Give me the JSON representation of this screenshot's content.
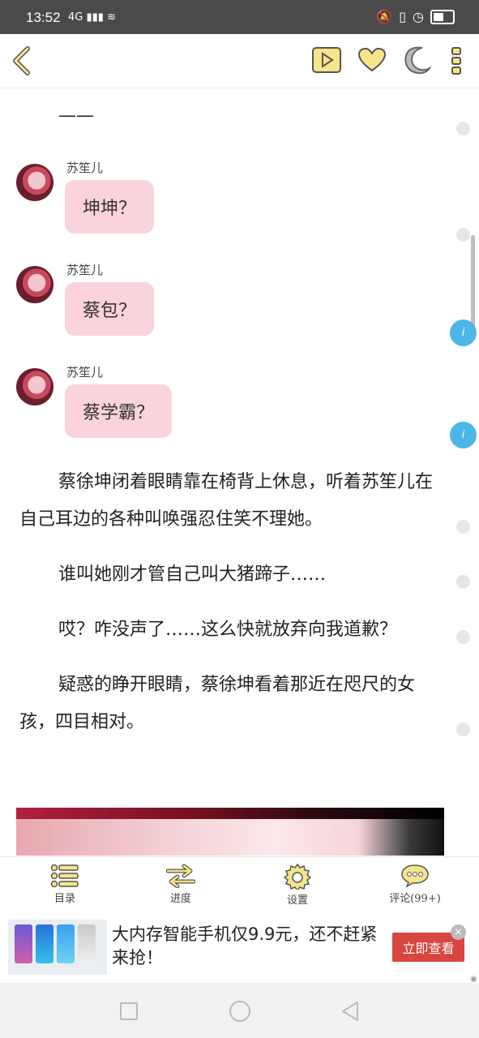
{
  "status_bar": {
    "time": "13:52",
    "signal": "4G",
    "battery_icon": "battery-icon"
  },
  "top_bar": {
    "back_icon": "chevron-left-icon",
    "play_icon": "play-icon",
    "favorite_icon": "heart-icon",
    "night_icon": "moon-icon",
    "more_icon": "more-vertical-icon",
    "accent": "#f7e58a"
  },
  "content": {
    "dash": "——",
    "messages": [
      {
        "name": "苏笙儿",
        "text": "坤坤？"
      },
      {
        "name": "苏笙儿",
        "text": "蔡包？"
      },
      {
        "name": "苏笙儿",
        "text": "蔡学霸？"
      }
    ],
    "paragraphs": [
      "蔡徐坤闭着眼睛靠在椅背上休息，听着苏笙儿在自己耳边的各种叫唤强忍住笑不理她。",
      "谁叫她刚才管自己叫大猪蹄子……",
      "哎？咋没声了……这么快就放弃向我道歉？",
      "疑惑的睁开眼睛，蔡徐坤看着那近在咫尺的女孩，四目相对。"
    ],
    "comment_badge": "i"
  },
  "bottom_tabs": [
    {
      "label": "目录",
      "icon": "list-icon"
    },
    {
      "label": "进度",
      "icon": "arrows-icon"
    },
    {
      "label": "设置",
      "icon": "gear-icon"
    },
    {
      "label": "评论(99+)",
      "icon": "comment-icon"
    }
  ],
  "ad": {
    "text": "大内存智能手机仅9.9元，还不赶紧来抢！",
    "button": "立即查看",
    "close": "×",
    "button_color": "#d9453f"
  }
}
